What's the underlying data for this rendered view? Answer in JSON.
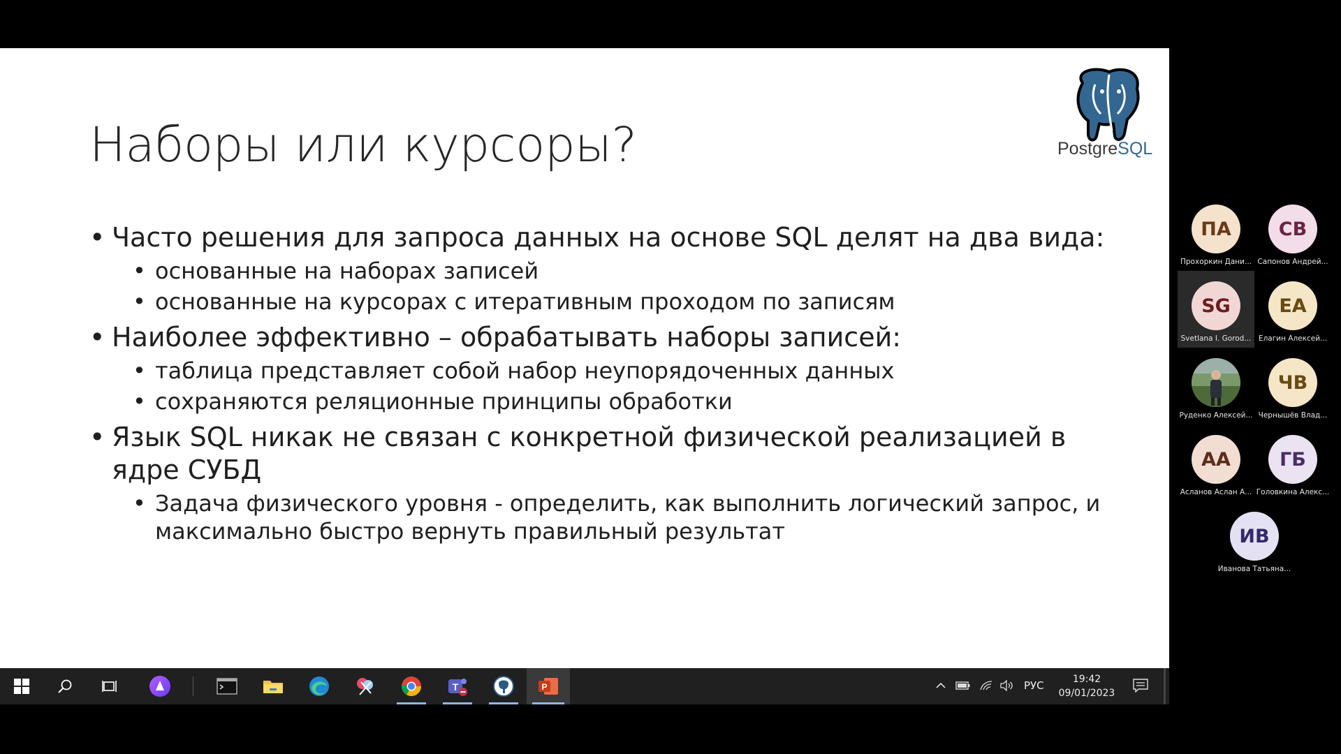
{
  "slide": {
    "title": "Наборы или курсоры?",
    "logo_text_prefix": "Postgre",
    "logo_text_suffix": "SQL",
    "bullets": [
      {
        "level": 1,
        "text": "Часто решения для запроса данных на основе SQL делят на два вида:"
      },
      {
        "level": 2,
        "text": "основанные на наборах записей"
      },
      {
        "level": 2,
        "text": "основанные на курсорах с итеративным проходом по записям"
      },
      {
        "level": 1,
        "text": "Наиболее эффективно – обрабатывать наборы записей:"
      },
      {
        "level": 2,
        "text": "таблица представляет собой набор неупорядоченных данных"
      },
      {
        "level": 2,
        "text": "сохраняются реляционные принципы обработки"
      },
      {
        "level": 1,
        "text": "Язык SQL никак не связан с конкретной физической реализацией в ядре СУБД"
      },
      {
        "level": 2,
        "text": "Задача физического уровня - определить, как выполнить логический запрос, и максимально быстро вернуть правильный результат"
      }
    ]
  },
  "participants": [
    {
      "initials": "ПА",
      "name": "Прохоркин Дани...",
      "bg": "#f4e2cc",
      "fg": "#6b3a1a"
    },
    {
      "initials": "СВ",
      "name": "Сапонов Андрей...",
      "bg": "#f3dde8",
      "fg": "#6a2444"
    },
    {
      "initials": "SG",
      "name": "Svetlana I. Gorod...",
      "bg": "#f1d6d6",
      "fg": "#6b1d1d",
      "speaking": true
    },
    {
      "initials": "ЕА",
      "name": "Елагин Алексей...",
      "bg": "#f5e6c8",
      "fg": "#6b4a12"
    },
    {
      "initials": "",
      "name": "Руденко Алексей...",
      "photo": true
    },
    {
      "initials": "ЧВ",
      "name": "Чернышёв Влад...",
      "bg": "#f5e6c8",
      "fg": "#6b4a12"
    },
    {
      "initials": "АА",
      "name": "Асланов Аслан А...",
      "bg": "#f1ddd2",
      "fg": "#5c2d1a"
    },
    {
      "initials": "ГБ",
      "name": "Головкина Алекс...",
      "bg": "#ebe2f2",
      "fg": "#4a2d66"
    },
    {
      "initials": "ИВ",
      "name": "Иванова Татьяна...",
      "bg": "#e4e1f3",
      "fg": "#33296b"
    }
  ],
  "taskbar": {
    "apps": [
      {
        "name": "start-button",
        "icon": "windows-logo-icon"
      },
      {
        "name": "search-button",
        "icon": "search-icon"
      },
      {
        "name": "task-view-button",
        "icon": "task-view-icon"
      },
      {
        "name": "assistant-button",
        "icon": "alice-assistant-icon"
      },
      {
        "name": "terminal-app",
        "icon": "terminal-icon"
      },
      {
        "name": "file-explorer-app",
        "icon": "folder-icon"
      },
      {
        "name": "edge-app",
        "icon": "edge-icon"
      },
      {
        "name": "snipping-app",
        "icon": "snip-icon"
      },
      {
        "name": "chrome-app",
        "icon": "chrome-icon"
      },
      {
        "name": "teams-app",
        "icon": "teams-icon"
      },
      {
        "name": "pgadmin-app",
        "icon": "elephant-icon"
      },
      {
        "name": "powerpoint-app",
        "icon": "powerpoint-icon"
      }
    ],
    "language": "РУС",
    "time": "19:42",
    "date": "09/01/2023"
  }
}
